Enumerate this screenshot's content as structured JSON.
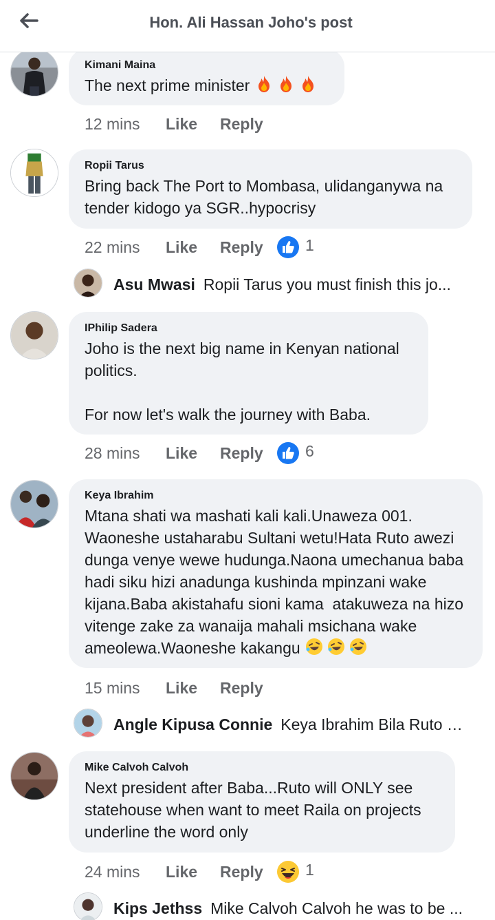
{
  "header": {
    "title": "Hon. Ali Hassan Joho's post",
    "back_icon": "arrow-left-icon"
  },
  "labels": {
    "like": "Like",
    "reply": "Reply"
  },
  "colors": {
    "bubble": "#f0f2f5",
    "like_blue": "#1877f2",
    "meta_gray": "#65676b"
  },
  "comments": [
    {
      "author": "Kimani Maina",
      "text": "The next prime minister",
      "trailing_emoji": [
        "fire-emoji",
        "fire-emoji",
        "fire-emoji"
      ],
      "time": "12 mins"
    },
    {
      "author": "Ropii Tarus",
      "text": "Bring back The Port to Mombasa, ulidanganywa na tender kidogo ya SGR..hypocrisy",
      "time": "22 mins",
      "reaction": "like-reaction-icon",
      "reaction_count": "1",
      "reply_preview": {
        "name": "Asu Mwasi",
        "text": "Ropii Tarus you must finish this jo..."
      }
    },
    {
      "author": "IPhilip Sadera",
      "text": "Joho is the next big name in Kenyan national politics.\n\nFor now let's walk the journey with Baba.",
      "time": "28 mins",
      "reaction": "like-reaction-icon",
      "reaction_count": "6"
    },
    {
      "author": "Keya Ibrahim",
      "text": "Mtana shati wa mashati kali kali.Unaweza 001. Waoneshe ustaharabu Sultani wetu!Hata Ruto awezi dunga venye wewe hudunga.Naona umechanua baba hadi siku hizi anadunga kushinda mpinzani wake kijana.Baba akistahafu sioni kama  atakuweza na hizo vitenge zake za wanaija mahali msichana wake ameolewa.Waoneshe kakangu",
      "trailing_emoji": [
        "rofl-emoji",
        "rofl-emoji",
        "rofl-emoji"
      ],
      "time": "15 mins",
      "reply_preview": {
        "name": "Angle Kipusa Connie",
        "text": "Keya Ibrahim Bila Ruto h..."
      }
    },
    {
      "author": "Mike Calvoh Calvoh",
      "text": "Next president after Baba...Ruto will ONLY see statehouse when want to meet Raila on projects underline the word only",
      "time": "24 mins",
      "reaction": "haha-reaction-icon",
      "reaction_count": "1",
      "reply_preview": {
        "name": "Kips Jethss",
        "text": "Mike Calvoh Calvoh he was to be ..."
      }
    }
  ]
}
